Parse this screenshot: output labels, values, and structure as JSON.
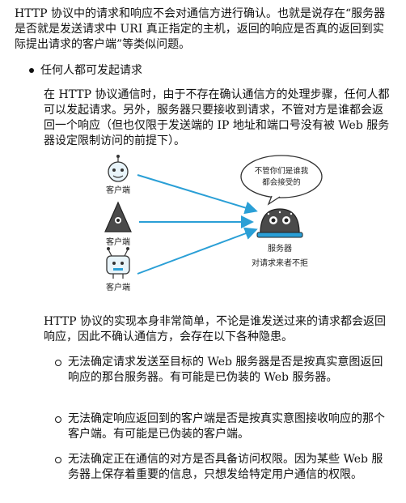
{
  "intro": "HTTP 协议中的请求和响应不会对通信方进行确认。也就是说存在“服务器是否就是发送请求中 URI 真正指定的主机，返回的响应是否真的返回到实际提出请求的客户端”等类似问题。",
  "bullet": "任何人都可发起请求",
  "explain": "在 HTTP 协议通信时，由于不存在确认通信方的处理步骤，任何人都可以发起请求。另外，服务器只要接收到请求，不管对方是谁都会返回一个响应（但也仅限于发送端的 IP 地址和端口号没有被 Web 服务器设定限制访问的前提下）。",
  "figure": {
    "client_label": "客户端",
    "server_label": "服务器",
    "caption": "对请求来者不拒",
    "speech_line1": "不管你们是谁我",
    "speech_line2": "都会接受的"
  },
  "risk_intro": "HTTP 协议的实现本身非常简单，不论是谁发送过来的请求都会返回响应，因此不确认通信方，会存在以下各种隐患。",
  "risks": [
    "无法确定请求发送至目标的 Web 服务器是否是按真实意图返回响应的那台服务器。有可能是已伪装的 Web 服务器。",
    "无法确定响应返回到的客户端是否是按真实意图接收响应的那个客户端。有可能是已伪装的客户端。",
    "无法确定正在通信的对方是否具备访问权限。因为某些 Web 服务器上保存着重要的信息，只想发给特定用户通信的权限。"
  ]
}
